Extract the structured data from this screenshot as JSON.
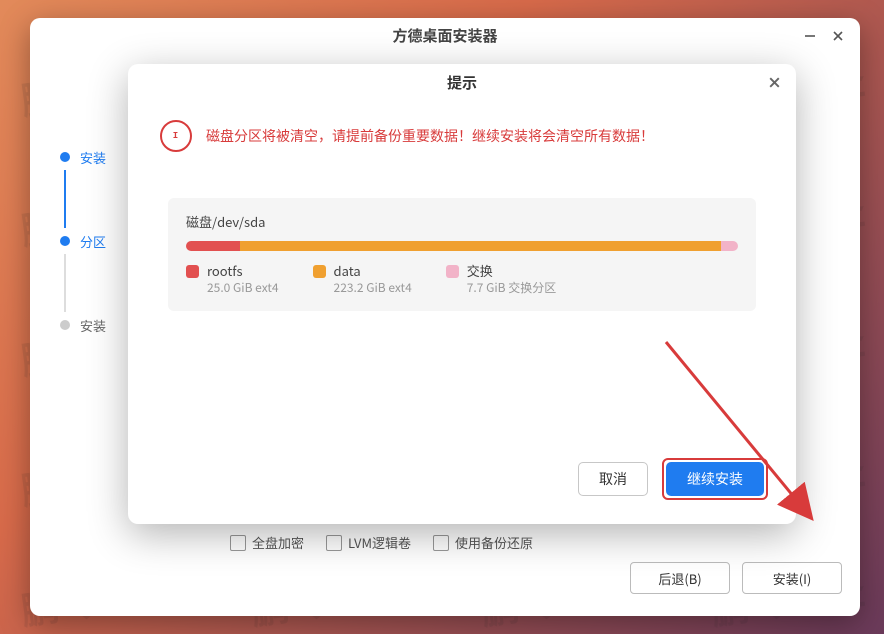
{
  "window": {
    "title": "方德桌面安装器"
  },
  "steps": {
    "s1": "安装",
    "s2": "分区",
    "s3": "安装"
  },
  "options": {
    "full_disk_encrypt": "全盘加密",
    "lvm": "LVM逻辑卷",
    "restore_backup": "使用备份还原"
  },
  "footer": {
    "back": "后退(B)",
    "install": "安装(I)"
  },
  "modal": {
    "title": "提示",
    "warning": "磁盘分区将被清空，请提前备份重要数据！继续安装将会清空所有数据！",
    "disk_label": "磁盘/dev/sda",
    "partitions": {
      "rootfs": {
        "name": "rootfs",
        "detail": "25.0 GiB  ext4"
      },
      "data": {
        "name": "data",
        "detail": "223.2 GiB  ext4"
      },
      "swap": {
        "name": "交换",
        "detail": "7.7 GiB  交换分区"
      }
    },
    "cancel": "取消",
    "continue": "继续安装"
  },
  "watermark": "鹏 大 圣"
}
